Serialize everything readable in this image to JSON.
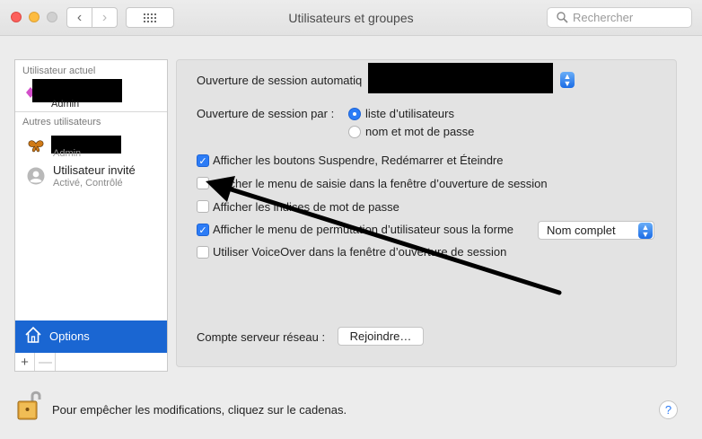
{
  "window": {
    "title": "Utilisateurs et groupes"
  },
  "toolbar": {
    "back_glyph": "‹",
    "forward_glyph": "›",
    "search_placeholder": "Rechercher"
  },
  "sidebar": {
    "current_header": "Utilisateur actuel",
    "current_user": {
      "sub": "Admin",
      "redacted": true
    },
    "others_header": "Autres utilisateurs",
    "other_user": {
      "sub": "Admin",
      "redacted": true,
      "avatar": "butterfly-icon"
    },
    "guest": {
      "name": "Utilisateur invité",
      "sub": "Activé, Contrôlé"
    },
    "options_label": "Options",
    "add_label": "+",
    "remove_label": "—"
  },
  "panel": {
    "autologin_label": "Ouverture de session automatiq",
    "autologin_value_redacted": true,
    "display_label": "Ouverture de session par :",
    "radio_options": [
      {
        "label": "liste d’utilisateurs",
        "selected": true
      },
      {
        "label": "nom et mot de passe",
        "selected": false
      }
    ],
    "checkboxes": [
      {
        "label": "Afficher les boutons Suspendre, Redémarrer et Éteindre",
        "checked": true
      },
      {
        "label": "Afficher le menu de saisie dans la fenêtre d’ouverture de session",
        "checked": false
      },
      {
        "label": "Afficher les indices de mot de passe",
        "checked": false
      },
      {
        "label": "Afficher le menu de permutation d’utilisateur sous la forme",
        "checked": true
      },
      {
        "label": "Utiliser VoiceOver dans la fenêtre d’ouverture de session",
        "checked": false
      }
    ],
    "switch_format_value": "Nom complet",
    "network_label": "Compte serveur réseau :",
    "join_button": "Rejoindre…"
  },
  "footer": {
    "lock_text": "Pour empêcher les modifications, cliquez sur le cadenas.",
    "help_label": "?"
  },
  "colors": {
    "accent": "#2c7cf6",
    "selection": "#1a66d2"
  }
}
